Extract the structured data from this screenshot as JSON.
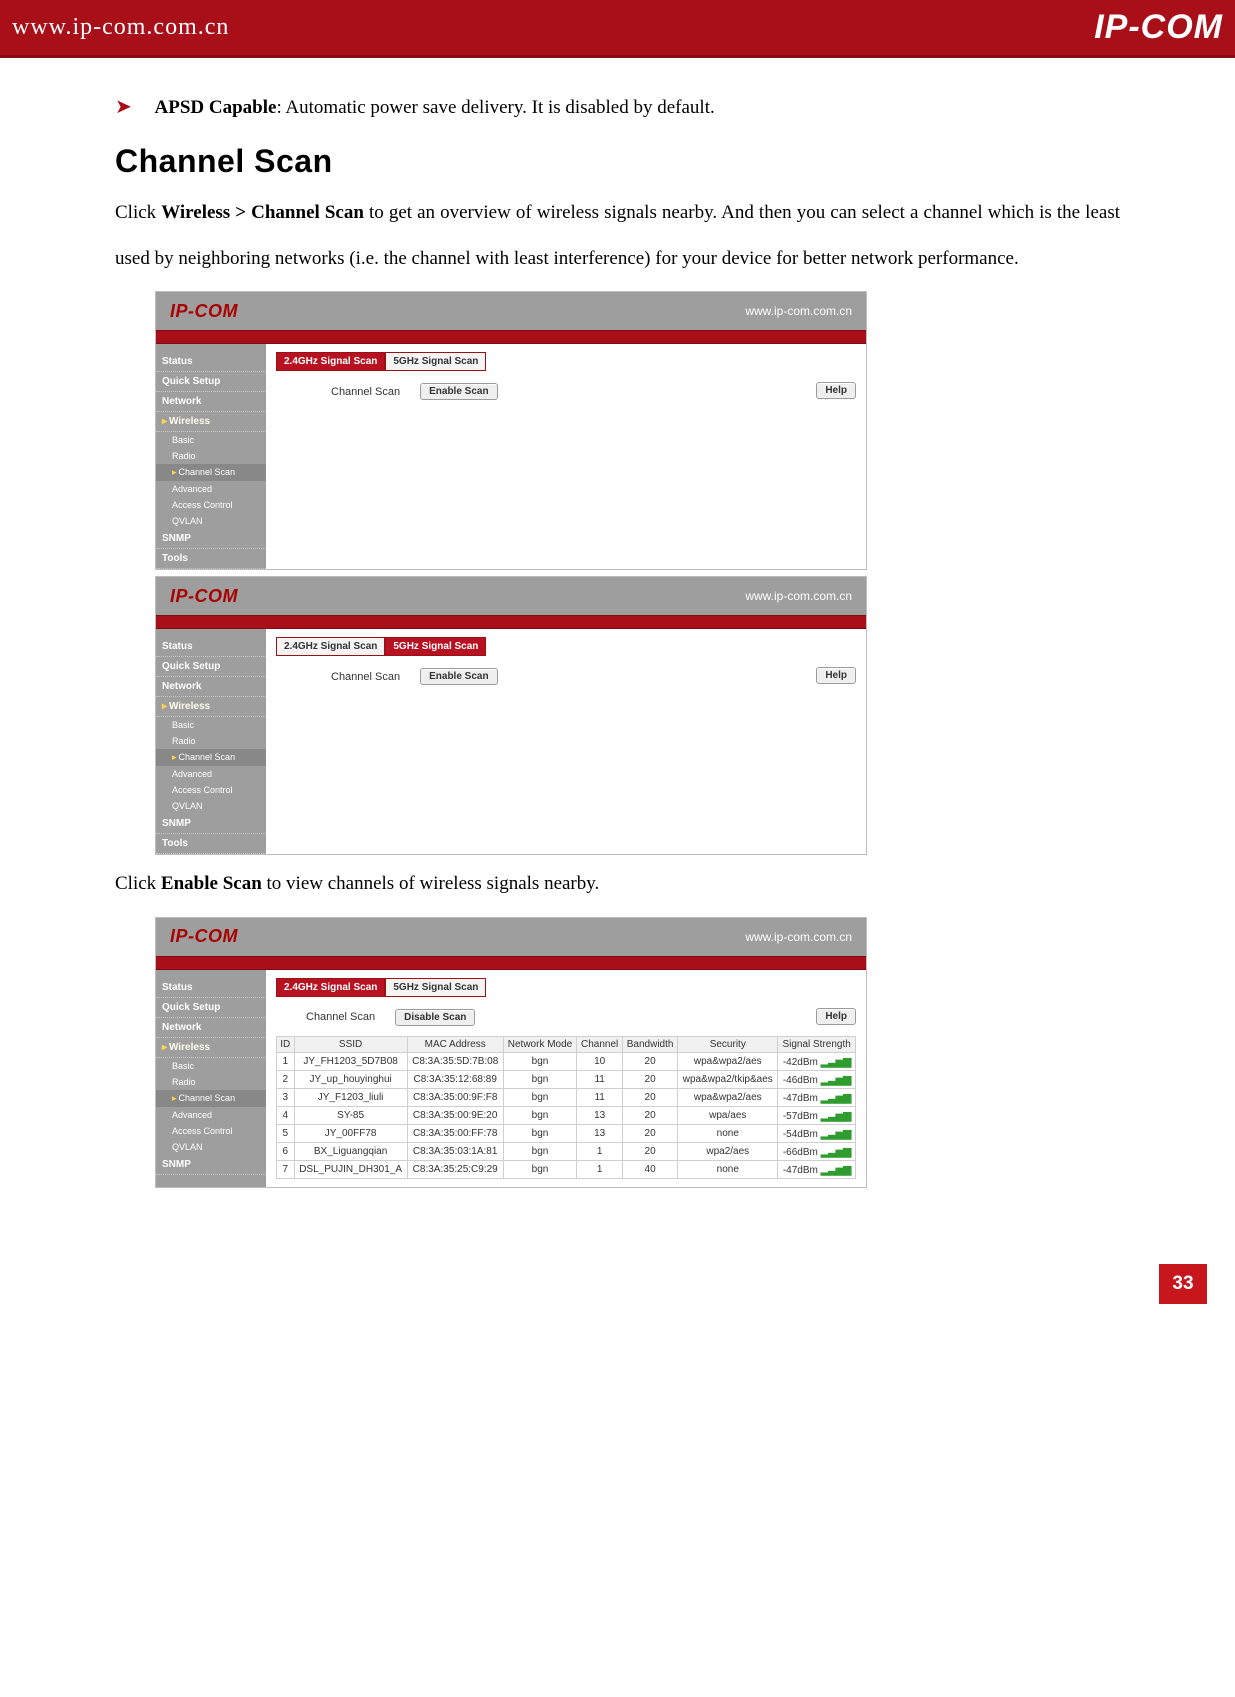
{
  "header": {
    "url": "www.ip-com.com.cn",
    "logo": "IP-COM"
  },
  "bullet": {
    "term": "APSD Capable",
    "desc": ": Automatic power save delivery. It is disabled by default."
  },
  "section_title": "Channel Scan",
  "intro_pre": "Click ",
  "intro_bold1": "Wireless > Channel Scan",
  "intro_post": " to get an overview of wireless signals nearby. And then you can select a channel which is the least used by neighboring networks (i.e. the channel with least interference) for your device for better network performance.",
  "mid_pre": "Click ",
  "mid_bold": "Enable Scan",
  "mid_post": " to view channels of wireless signals nearby.",
  "shot_common": {
    "logo": "IP-COM",
    "url": "www.ip-com.com.cn",
    "nav": [
      "Status",
      "Quick Setup",
      "Network",
      "Wireless",
      "Basic",
      "Radio",
      "Channel Scan",
      "Advanced",
      "Access Control",
      "QVLAN",
      "SNMP",
      "Tools"
    ],
    "tab24": "2.4GHz Signal Scan",
    "tab5": "5GHz Signal Scan",
    "label_channel_scan": "Channel Scan",
    "btn_enable": "Enable Scan",
    "btn_disable": "Disable Scan",
    "btn_help": "Help"
  },
  "scan_headers": [
    "ID",
    "SSID",
    "MAC Address",
    "Network Mode",
    "Channel",
    "Bandwidth",
    "Security",
    "Signal Strength"
  ],
  "scan_rows": [
    {
      "id": "1",
      "ssid": "JY_FH1203_5D7B08",
      "mac": "C8:3A:35:5D:7B:08",
      "mode": "bgn",
      "ch": "10",
      "bw": "20",
      "sec": "wpa&wpa2/aes",
      "sig": "-42dBm"
    },
    {
      "id": "2",
      "ssid": "JY_up_houyinghui",
      "mac": "C8:3A:35:12:68:89",
      "mode": "bgn",
      "ch": "11",
      "bw": "20",
      "sec": "wpa&wpa2/tkip&aes",
      "sig": "-46dBm"
    },
    {
      "id": "3",
      "ssid": "JY_F1203_liuli",
      "mac": "C8:3A:35:00:9F:F8",
      "mode": "bgn",
      "ch": "11",
      "bw": "20",
      "sec": "wpa&wpa2/aes",
      "sig": "-47dBm"
    },
    {
      "id": "4",
      "ssid": "SY-85",
      "mac": "C8:3A:35:00:9E:20",
      "mode": "bgn",
      "ch": "13",
      "bw": "20",
      "sec": "wpa/aes",
      "sig": "-57dBm"
    },
    {
      "id": "5",
      "ssid": "JY_00FF78",
      "mac": "C8:3A:35:00:FF:78",
      "mode": "bgn",
      "ch": "13",
      "bw": "20",
      "sec": "none",
      "sig": "-54dBm"
    },
    {
      "id": "6",
      "ssid": "BX_Liguangqian",
      "mac": "C8:3A:35:03:1A:81",
      "mode": "bgn",
      "ch": "1",
      "bw": "20",
      "sec": "wpa2/aes",
      "sig": "-66dBm"
    },
    {
      "id": "7",
      "ssid": "DSL_PUJIN_DH301_A",
      "mac": "C8:3A:35:25:C9:29",
      "mode": "bgn",
      "ch": "1",
      "bw": "40",
      "sec": "none",
      "sig": "-47dBm"
    }
  ],
  "page_number": "33"
}
